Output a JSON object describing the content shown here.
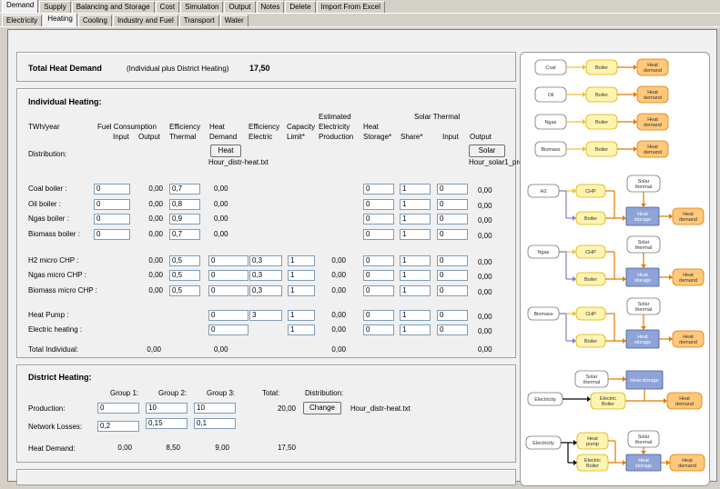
{
  "tabs_top": [
    "Demand",
    "Supply",
    "Balancing and Storage",
    "Cost",
    "Simulation",
    "Output",
    "Notes",
    "Delete",
    "Import From Excel"
  ],
  "tabs_sub": [
    "Electricity",
    "Heating",
    "Cooling",
    "Industry and Fuel",
    "Transport",
    "Water"
  ],
  "total": {
    "label": "Total Heat Demand",
    "sub": "(Individual plus District Heating)",
    "value": "17,50"
  },
  "ind": {
    "title": "Individual Heating:",
    "headers": {
      "twh": "TWh/year",
      "fuel": "Fuel Consumption",
      "input": "Input",
      "output": "Output",
      "eff1": "Efficiency",
      "thermal": "Thermal",
      "heat": "Heat",
      "demand": "Demand",
      "eff2": "Efficiency",
      "electric": "Electric",
      "cap": "Capacity",
      "limit": "Limit*",
      "est": "Estimated",
      "elec": "Electricity",
      "prod": "Production",
      "hs1": "Heat",
      "hs2": "Storage*",
      "solar": "Solar Thermal",
      "share": "Share*",
      "sinput": "Input",
      "soutput": "Output"
    },
    "distribution": "Distribution:",
    "heat_btn": "Heat",
    "heat_file": "Hour_distr-heat.txt",
    "solar_btn": "Solar",
    "solar_file": "Hour_solar1_prod.txt",
    "rows": [
      {
        "label": "Coal boiler :",
        "input": "0",
        "output": "0,00",
        "eff": "0,7",
        "demand": "0,00",
        "storage": "0",
        "share": "1",
        "sin": "0",
        "sout": "0,00"
      },
      {
        "label": "Oil boiler :",
        "input": "0",
        "output": "0,00",
        "eff": "0,8",
        "demand": "0,00",
        "storage": "0",
        "share": "1",
        "sin": "0",
        "sout": "0,00"
      },
      {
        "label": "Ngas boiler :",
        "input": "0",
        "output": "0,00",
        "eff": "0,9",
        "demand": "0,00",
        "storage": "0",
        "share": "1",
        "sin": "0",
        "sout": "0,00"
      },
      {
        "label": "Biomass boiler :",
        "input": "0",
        "output": "0,00",
        "eff": "0,7",
        "demand": "0,00",
        "storage": "0",
        "share": "1",
        "sin": "0",
        "sout": "0,00"
      },
      {
        "label": "H2 micro CHP :",
        "output": "0,00",
        "eff": "0,5",
        "demand": "0",
        "effel": "0,3",
        "cap": "1",
        "est": "0,00",
        "storage": "0",
        "share": "1",
        "sin": "0",
        "sout": "0,00"
      },
      {
        "label": "Ngas micro CHP :",
        "output": "0,00",
        "eff": "0,5",
        "demand": "0",
        "effel": "0,3",
        "cap": "1",
        "est": "0,00",
        "storage": "0",
        "share": "1",
        "sin": "0",
        "sout": "0,00"
      },
      {
        "label": "Biomass micro CHP :",
        "output": "0,00",
        "eff": "0,5",
        "demand": "0",
        "effel": "0,3",
        "cap": "1",
        "est": "0,00",
        "storage": "0",
        "share": "1",
        "sin": "0",
        "sout": "0,00"
      },
      {
        "label": "Heat Pump :",
        "demand": "0",
        "effel": "3",
        "cap": "1",
        "est": "0,00",
        "storage": "0",
        "share": "1",
        "sin": "0",
        "sout": "0,00"
      },
      {
        "label": "Electric heating :",
        "demand": "0",
        "cap": "1",
        "est": "0,00",
        "storage": "0",
        "share": "1",
        "sin": "0",
        "sout": "0,00"
      }
    ],
    "total": {
      "label": "Total Individual:",
      "output": "0,00",
      "demand": "0,00",
      "est": "0,00",
      "sout": "0,00"
    }
  },
  "dist": {
    "title": "District Heating:",
    "g1": "Group 1:",
    "g2": "Group 2:",
    "g3": "Group 3:",
    "total": "Total:",
    "distribution": "Distribution:",
    "production_label": "Production:",
    "p1": "0",
    "p2": "10",
    "p3": "10",
    "ptotal": "20,00",
    "change_btn": "Change",
    "file": "Hour_distr-heat.txt",
    "losses_label": "Network Losses:",
    "l1": "0,2",
    "l2": "0,15",
    "l3": "0,1",
    "demand_label": "Heat Demand:",
    "d1": "0,00",
    "d2": "8,50",
    "d3": "9,00",
    "dtotal": "17,50"
  },
  "diagram": {
    "coal": "Coal",
    "oil": "Oil",
    "ngas": "Ngas",
    "biomass": "Biomass",
    "boiler": "Boiler",
    "heat": "Heat",
    "demand": "demand",
    "h2": "H2",
    "chp": "CHP",
    "solar": "Solar",
    "thermal": "thermal",
    "storage": "storage",
    "heat_storage": "Heat storage",
    "electricity": "Electricity",
    "electric": "Electric",
    "pump": "pump"
  },
  "colors": {
    "yellow": "#fff3b0",
    "yellow_border": "#e0b000",
    "orange": "#ffc87a",
    "orange_border": "#e07b00",
    "blue": "#8fa3d6",
    "blue_border": "#3d5a9e",
    "gray": "#b8b8d8"
  }
}
